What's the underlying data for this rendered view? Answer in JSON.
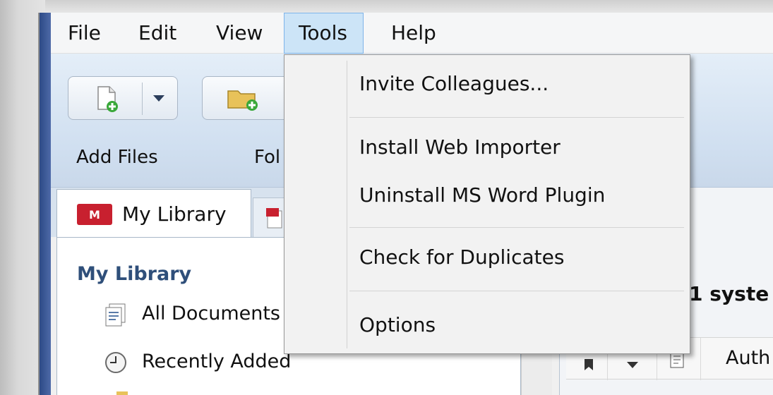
{
  "menubar": {
    "items": [
      {
        "label": "File"
      },
      {
        "label": "Edit"
      },
      {
        "label": "View"
      },
      {
        "label": "Tools",
        "active": true
      },
      {
        "label": "Help"
      }
    ]
  },
  "toolbar": {
    "add_files_label": "Add Files",
    "folder_label_partial": "Fol"
  },
  "tools_menu": {
    "items": [
      {
        "label": "Invite Colleagues..."
      },
      {
        "label": "Install Web Importer"
      },
      {
        "label": "Uninstall MS Word Plugin"
      },
      {
        "label": "Check for Duplicates"
      },
      {
        "label": "Options"
      }
    ]
  },
  "left_panel": {
    "tab_label": "My Library",
    "heading": "My Library",
    "items": [
      {
        "label": "All Documents",
        "icon": "documents-icon"
      },
      {
        "label": "Recently Added",
        "icon": "clock-icon"
      }
    ]
  },
  "right_panel": {
    "title_partial": "1 syste",
    "column_author_partial": "Auth"
  },
  "colors": {
    "menu_active_bg": "#cce4f7",
    "menu_active_border": "#7eb4ea",
    "toolbar_gradient_top": "#e4eef8",
    "heading_blue": "#2f4f7a",
    "mendeley_red": "#c8202f"
  }
}
